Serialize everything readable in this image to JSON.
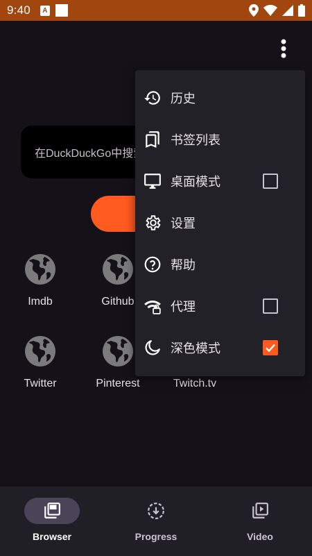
{
  "status_bar": {
    "time": "9:40",
    "a_icon": "A"
  },
  "search": {
    "placeholder_text": "在DuckDuckGo中搜索"
  },
  "shortcuts": [
    {
      "label": "Imdb"
    },
    {
      "label": "Github"
    },
    {
      "label": "Twitter"
    },
    {
      "label": "Pinterest"
    },
    {
      "label": "Twitch.tv"
    }
  ],
  "menu": {
    "items": [
      {
        "label": "历史",
        "icon": "history-icon"
      },
      {
        "label": "书签列表",
        "icon": "bookmark-icon"
      },
      {
        "label": "桌面模式",
        "icon": "desktop-icon",
        "checkbox": false
      },
      {
        "label": "设置",
        "icon": "settings-icon"
      },
      {
        "label": "帮助",
        "icon": "help-icon"
      },
      {
        "label": "代理",
        "icon": "proxy-icon",
        "checkbox": false
      },
      {
        "label": "深色模式",
        "icon": "dark-mode-icon",
        "checkbox": true
      }
    ]
  },
  "bottom_nav": {
    "items": [
      {
        "label": "Browser",
        "active": true
      },
      {
        "label": "Progress",
        "active": false
      },
      {
        "label": "Video",
        "active": false
      }
    ]
  },
  "colors": {
    "accent": "#ff5a1f",
    "status_bar": "#a0460e",
    "background": "#141218",
    "menu_background": "#222127"
  }
}
